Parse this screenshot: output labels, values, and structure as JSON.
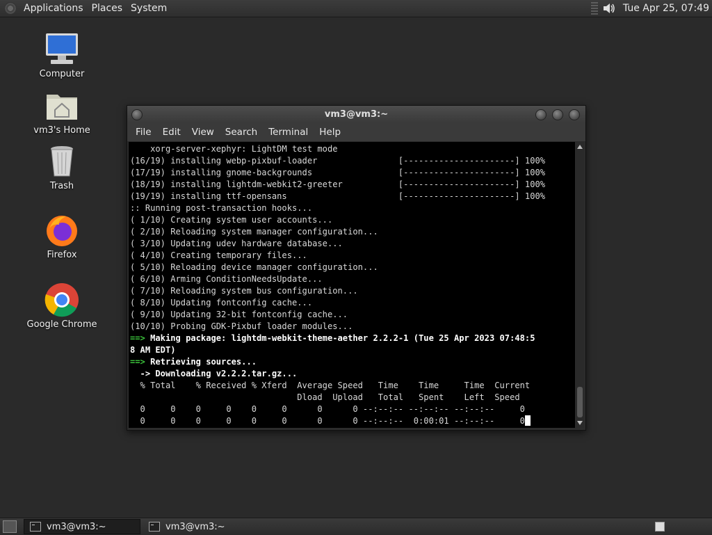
{
  "top_panel": {
    "menus": [
      "Applications",
      "Places",
      "System"
    ],
    "clock": "Tue Apr 25, 07:49"
  },
  "desktop": {
    "icons": [
      {
        "label": "Computer",
        "icon": "computer-icon"
      },
      {
        "label": "vm3's Home",
        "icon": "home-folder-icon"
      },
      {
        "label": "Trash",
        "icon": "trash-icon"
      },
      {
        "label": "Firefox",
        "icon": "firefox-icon"
      },
      {
        "label": "Google Chrome",
        "icon": "chrome-icon"
      }
    ]
  },
  "terminal": {
    "title": "vm3@vm3:~",
    "menus": [
      "File",
      "Edit",
      "View",
      "Search",
      "Terminal",
      "Help"
    ],
    "lines": [
      {
        "t": "    xorg-server-xephyr: LightDM test mode"
      },
      {
        "t": "(16/19) installing webp-pixbuf-loader                [----------------------] 100%"
      },
      {
        "t": "(17/19) installing gnome-backgrounds                 [----------------------] 100%"
      },
      {
        "t": "(18/19) installing lightdm-webkit2-greeter           [----------------------] 100%"
      },
      {
        "t": "(19/19) installing ttf-opensans                      [----------------------] 100%"
      },
      {
        "t": ":: Running post-transaction hooks..."
      },
      {
        "t": "( 1/10) Creating system user accounts..."
      },
      {
        "t": "( 2/10) Reloading system manager configuration..."
      },
      {
        "t": "( 3/10) Updating udev hardware database..."
      },
      {
        "t": "( 4/10) Creating temporary files..."
      },
      {
        "t": "( 5/10) Reloading device manager configuration..."
      },
      {
        "t": "( 6/10) Arming ConditionNeedsUpdate..."
      },
      {
        "t": "( 7/10) Reloading system bus configuration..."
      },
      {
        "t": "( 8/10) Updating fontconfig cache..."
      },
      {
        "t": "( 9/10) Updating 32-bit fontconfig cache..."
      },
      {
        "t": "(10/10) Probing GDK-Pixbuf loader modules..."
      },
      {
        "p": "==>",
        "pc": "g",
        "t": " Making package: lightdm-webkit-theme-aether 2.2.2-1 (Tue 25 Apr 2023 07:48:5",
        "c": "b"
      },
      {
        "t": "8 AM EDT)",
        "c": "b"
      },
      {
        "p": "==>",
        "pc": "g",
        "t": " Retrieving sources...",
        "c": "b"
      },
      {
        "t": "  -> Downloading v2.2.2.tar.gz...",
        "c": "b"
      },
      {
        "t": "  % Total    % Received % Xferd  Average Speed   Time    Time     Time  Current"
      },
      {
        "t": "                                 Dload  Upload   Total   Spent    Left  Speed"
      },
      {
        "t": "  0     0    0     0    0     0      0      0 --:--:-- --:--:-- --:--:--     0"
      },
      {
        "t": "  0     0    0     0    0     0      0      0 --:--:--  0:00:01 --:--:--     0",
        "cursor": true
      }
    ]
  },
  "taskbar": {
    "tasks": [
      {
        "label": "vm3@vm3:~",
        "active": true
      },
      {
        "label": "vm3@vm3:~",
        "active": false
      }
    ]
  }
}
